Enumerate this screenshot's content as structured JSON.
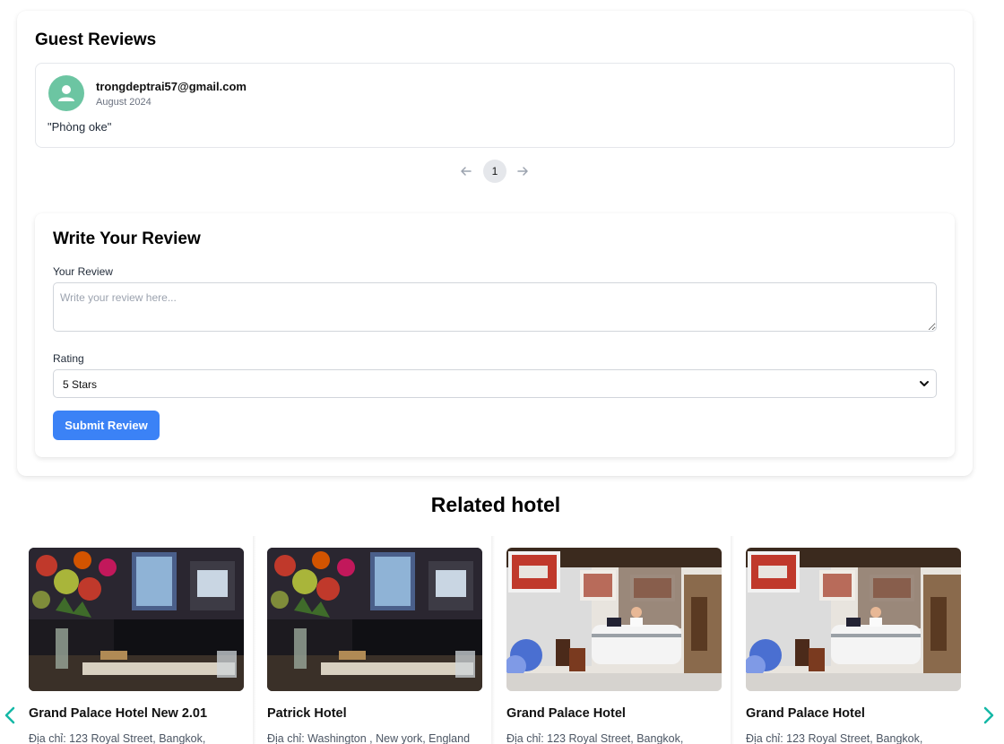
{
  "reviews": {
    "title": "Guest Reviews",
    "items": [
      {
        "user": "trongdeptrai57@gmail.com",
        "date": "August 2024",
        "text": "\"Phòng oke\""
      }
    ],
    "pagination": {
      "current": "1",
      "prev_icon": "arrow-left-icon",
      "next_icon": "arrow-right-icon"
    }
  },
  "write_review": {
    "title": "Write Your Review",
    "review_label": "Your Review",
    "review_placeholder": "Write your review here...",
    "review_value": "",
    "rating_label": "Rating",
    "rating_value": "5 Stars",
    "submit_label": "Submit Review"
  },
  "related": {
    "title": "Related hotel",
    "hotels": [
      {
        "name": "Grand Palace Hotel New 2.01",
        "address": "Địa chỉ: 123 Royal Street, Bangkok,"
      },
      {
        "name": "Patrick Hotel",
        "address": "Địa chỉ: Washington , New york, England"
      },
      {
        "name": "Grand Palace Hotel",
        "address": "Địa chỉ: 123 Royal Street, Bangkok,"
      },
      {
        "name": "Grand Palace Hotel",
        "address": "Địa chỉ: 123 Royal Street, Bangkok,"
      }
    ]
  },
  "colors": {
    "primary_button": "#3b82f6",
    "avatar_bg": "#6cc5a2",
    "carousel_arrow": "#14b8a6"
  }
}
